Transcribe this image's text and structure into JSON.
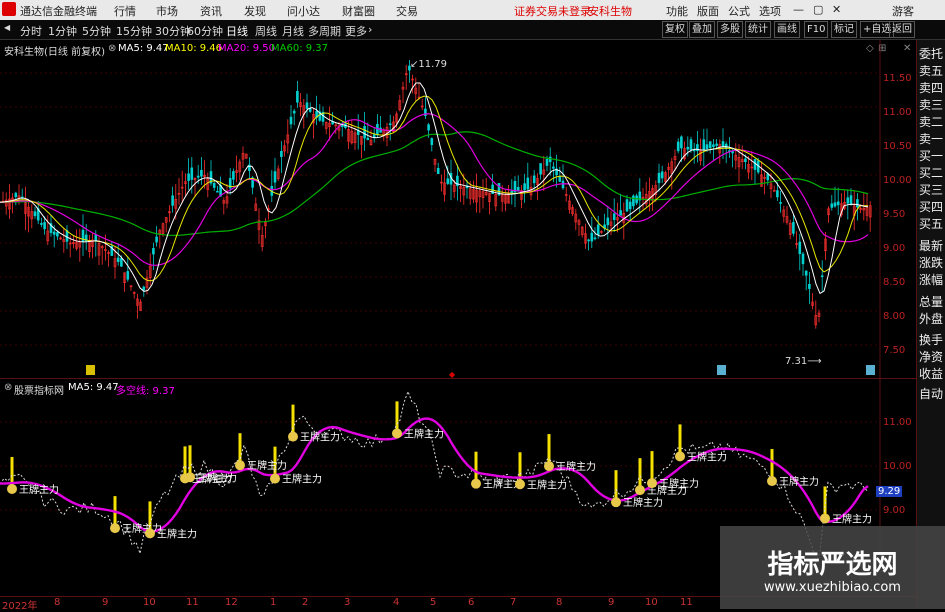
{
  "app": {
    "title": "通达信金融终端"
  },
  "menu": {
    "items": [
      "行情",
      "市场",
      "资讯",
      "发现",
      "问小达",
      "财富圈",
      "交易"
    ],
    "notice": "证券交易未登录",
    "stock": "安科生物",
    "right": [
      "功能",
      "版面",
      "公式",
      "选项"
    ],
    "user": "游客"
  },
  "toolbar": {
    "periods": [
      "分时",
      "1分钟",
      "5分钟",
      "15分钟",
      "30分钟",
      "60分钟",
      "日线",
      "周线",
      "月线",
      "多周期",
      "更多"
    ],
    "actions": [
      "复权",
      "叠加",
      "多股",
      "统计",
      "画线",
      "F10",
      "标记",
      "+自选",
      "返回"
    ]
  },
  "main_chart": {
    "title": "安科生物(日线 前复权)",
    "ma5": "MA5: 9.47",
    "ma10": "MA10: 9.46",
    "ma20": "MA20: 9.50",
    "ma60": "MA60: 9.37",
    "high_label": "11.79",
    "low_label": "7.31",
    "yticks": [
      "11.50",
      "11.00",
      "10.50",
      "10.00",
      "9.50",
      "9.00",
      "8.50",
      "8.00",
      "7.50"
    ],
    "colors": {
      "ma5": "#ffffff",
      "ma10": "#ffff00",
      "ma20": "#ff00ff",
      "ma60": "#00c000"
    }
  },
  "indicator": {
    "title": "股票指标网",
    "ma5": "MA5: 9.47",
    "line_label": "多空线: 9.37",
    "badge": "王牌主力",
    "yticks": [
      "11.00",
      "10.00",
      "9.00"
    ],
    "price_tag": "9.29"
  },
  "xaxis": {
    "labels": [
      "2022年",
      "8",
      "9",
      "10",
      "11",
      "12",
      "1",
      "2",
      "3",
      "4",
      "5",
      "6",
      "7",
      "8",
      "9",
      "10",
      "11"
    ]
  },
  "side": {
    "items": [
      "委托",
      "卖五",
      "卖四",
      "卖三",
      "卖二",
      "卖一",
      "买一",
      "买二",
      "买三",
      "买四",
      "买五",
      "最新",
      "涨跌",
      "涨幅",
      "总量",
      "外盘",
      "换手",
      "净资",
      "收益"
    ],
    "bottom": "自动"
  },
  "watermark": {
    "cn": "指标严选网",
    "url": "www.xuezhibiao.com"
  }
}
